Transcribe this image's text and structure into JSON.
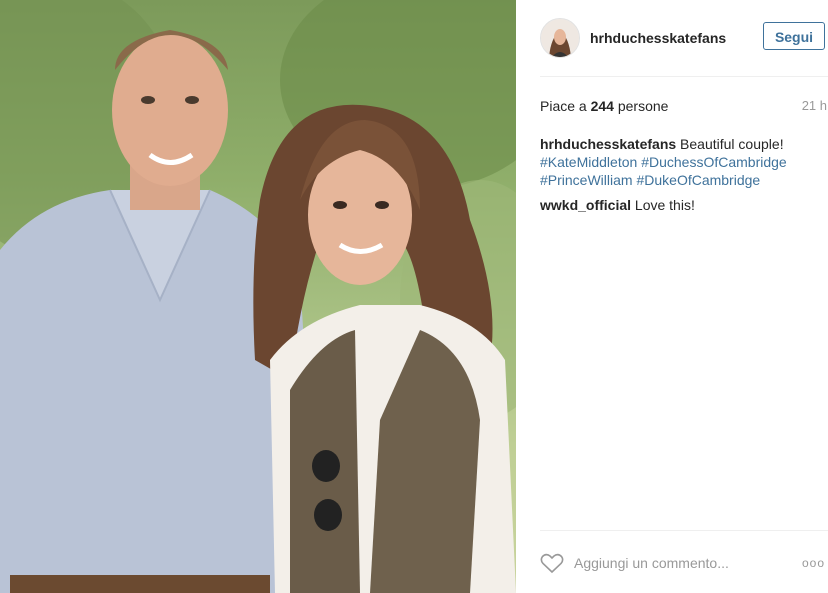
{
  "post": {
    "image_alt": "Couple smiling outdoors",
    "author": {
      "username": "hrhduchesskatefans"
    },
    "follow_label": "Segui",
    "likes": {
      "prefix": "Piace a ",
      "count": "244",
      "suffix": " persone"
    },
    "timestamp": "21 h",
    "caption": {
      "username": "hrhduchesskatefans",
      "text": " Beautiful couple! ",
      "hashtags": [
        "#KateMiddleton",
        "#DuchessOfCambridge",
        "#PrinceWilliam",
        "#DukeOfCambridge"
      ]
    },
    "comments": [
      {
        "username": "wwkd_official",
        "text": " Love this!"
      }
    ],
    "comment_placeholder": "Aggiungi un commento...",
    "more_label": "ooo"
  },
  "icons": {
    "like": "heart-outline-icon",
    "more": "more-options-icon"
  },
  "colors": {
    "link_blue": "#3f729b",
    "text": "#262626",
    "muted": "#999999"
  }
}
